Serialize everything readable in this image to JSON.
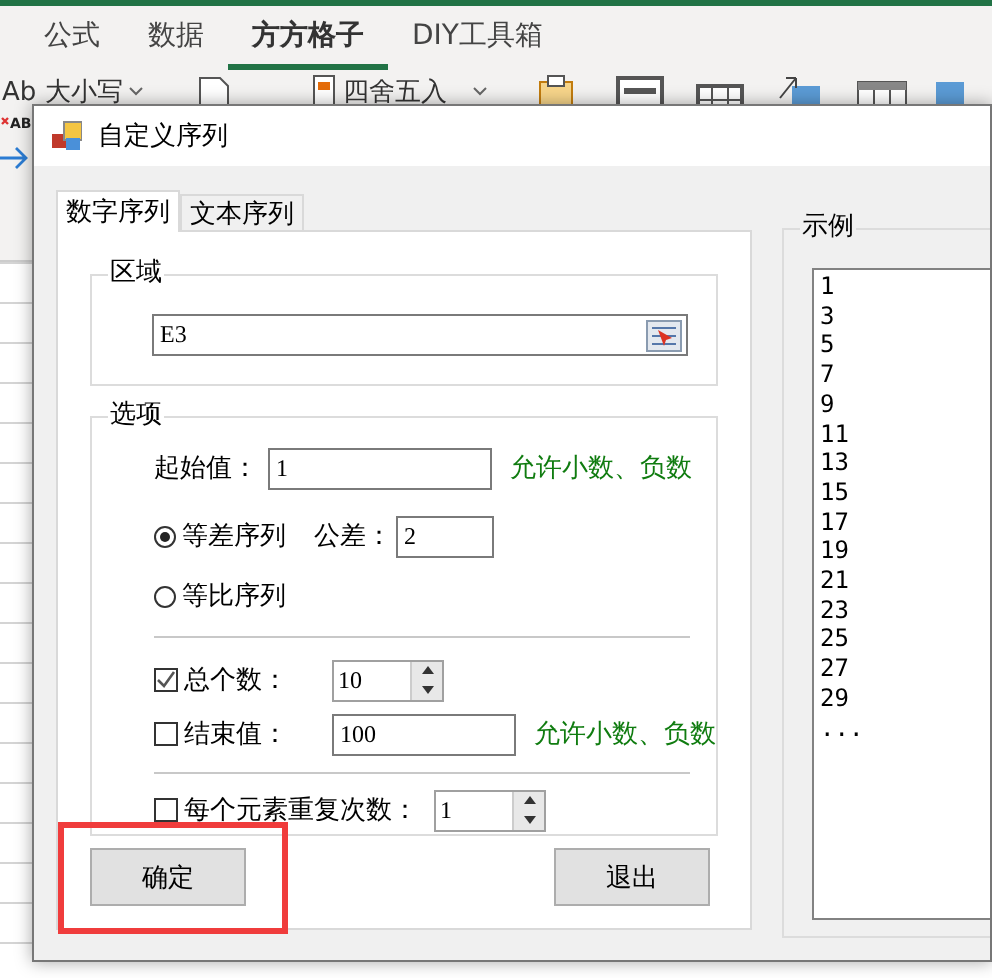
{
  "ribbon": {
    "tabs": [
      {
        "label": "公式",
        "selected": false
      },
      {
        "label": "数据",
        "selected": false
      },
      {
        "label": "方方格子",
        "selected": true
      },
      {
        "label": "DIY工具箱",
        "selected": false
      }
    ],
    "tools": [
      {
        "kind": "case",
        "icon_text": "Ab",
        "label": "大小写"
      },
      {
        "kind": "page"
      },
      {
        "kind": "round",
        "label": "四舍五入"
      },
      {
        "kind": "clipboard"
      },
      {
        "kind": "frame"
      },
      {
        "kind": "grid"
      },
      {
        "kind": "swap"
      },
      {
        "kind": "table"
      },
      {
        "kind": "blue"
      }
    ],
    "side_tools": [
      {
        "kind": "clear",
        "text": "AB"
      },
      {
        "kind": "arrow"
      }
    ]
  },
  "dialog": {
    "title": "自定义序列",
    "tabs": [
      {
        "label": "数字序列",
        "selected": true
      },
      {
        "label": "文本序列",
        "selected": false
      }
    ],
    "range_group": {
      "legend": "区域",
      "value": "E3"
    },
    "options_group": {
      "legend": "选项",
      "start": {
        "label": "起始值：",
        "value": "1",
        "hint": "允许小数、负数"
      },
      "modes": [
        {
          "label": "等差序列",
          "selected": true
        },
        {
          "label": "等比序列",
          "selected": false
        }
      ],
      "step": {
        "label": "公差：",
        "value": "2"
      },
      "count": {
        "label": "总个数：",
        "checked": true,
        "value": "10"
      },
      "end": {
        "label": "结束值：",
        "checked": false,
        "value": "100",
        "hint": "允许小数、负数"
      },
      "repeat": {
        "label": "每个元素重复次数：",
        "checked": false,
        "value": "1"
      }
    },
    "buttons": [
      {
        "label": "确定",
        "highlighted": true
      },
      {
        "label": "退出",
        "highlighted": false
      }
    ],
    "example": {
      "legend": "示例",
      "items": [
        "1",
        "3",
        "5",
        "7",
        "9",
        "11",
        "13",
        "15",
        "17",
        "19",
        "21",
        "23",
        "25",
        "27",
        "29",
        "..."
      ]
    }
  }
}
